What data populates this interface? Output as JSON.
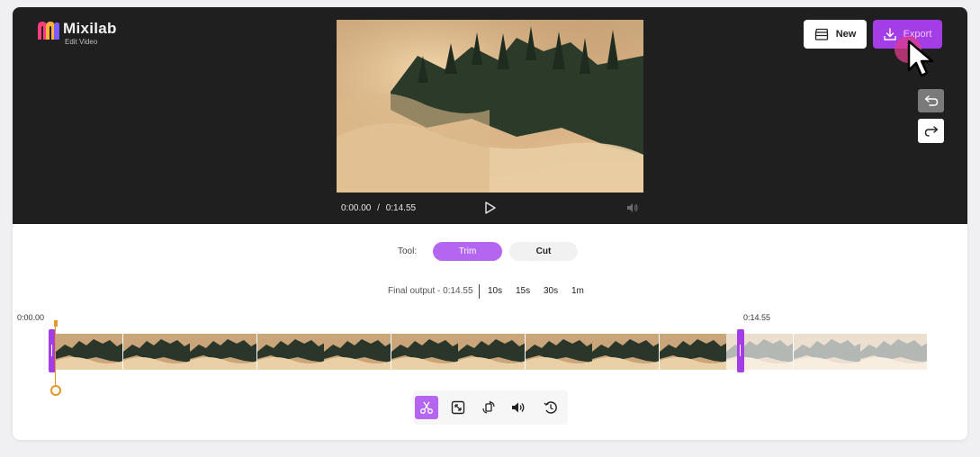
{
  "app": {
    "name": "Mixilab",
    "subtitle": "Edit Video"
  },
  "colors": {
    "accent": "#a33ee6",
    "accent_light": "#b466f0",
    "playhead": "#e8952a",
    "stage": "#1f1f1f"
  },
  "header": {
    "new_label": "New",
    "export_label": "Export",
    "undo_icon": "undo-icon",
    "redo_icon": "redo-icon"
  },
  "player": {
    "current_time": "0:00.00",
    "separator": "/",
    "duration": "0:14.55"
  },
  "tool": {
    "label": "Tool:",
    "options": [
      "Trim",
      "Cut"
    ],
    "selected": "Trim"
  },
  "output": {
    "text": "Final output - 0:14.55",
    "presets": [
      "10s",
      "15s",
      "30s",
      "1m"
    ]
  },
  "timeline": {
    "start_label": "0:00.00",
    "end_label": "0:14.55",
    "frames_total": 13,
    "frames_selected": 10
  },
  "toolbar": {
    "items": [
      "scissors-icon",
      "resize-icon",
      "rotate-icon",
      "volume-icon",
      "speed-icon"
    ],
    "active": "scissors-icon"
  }
}
